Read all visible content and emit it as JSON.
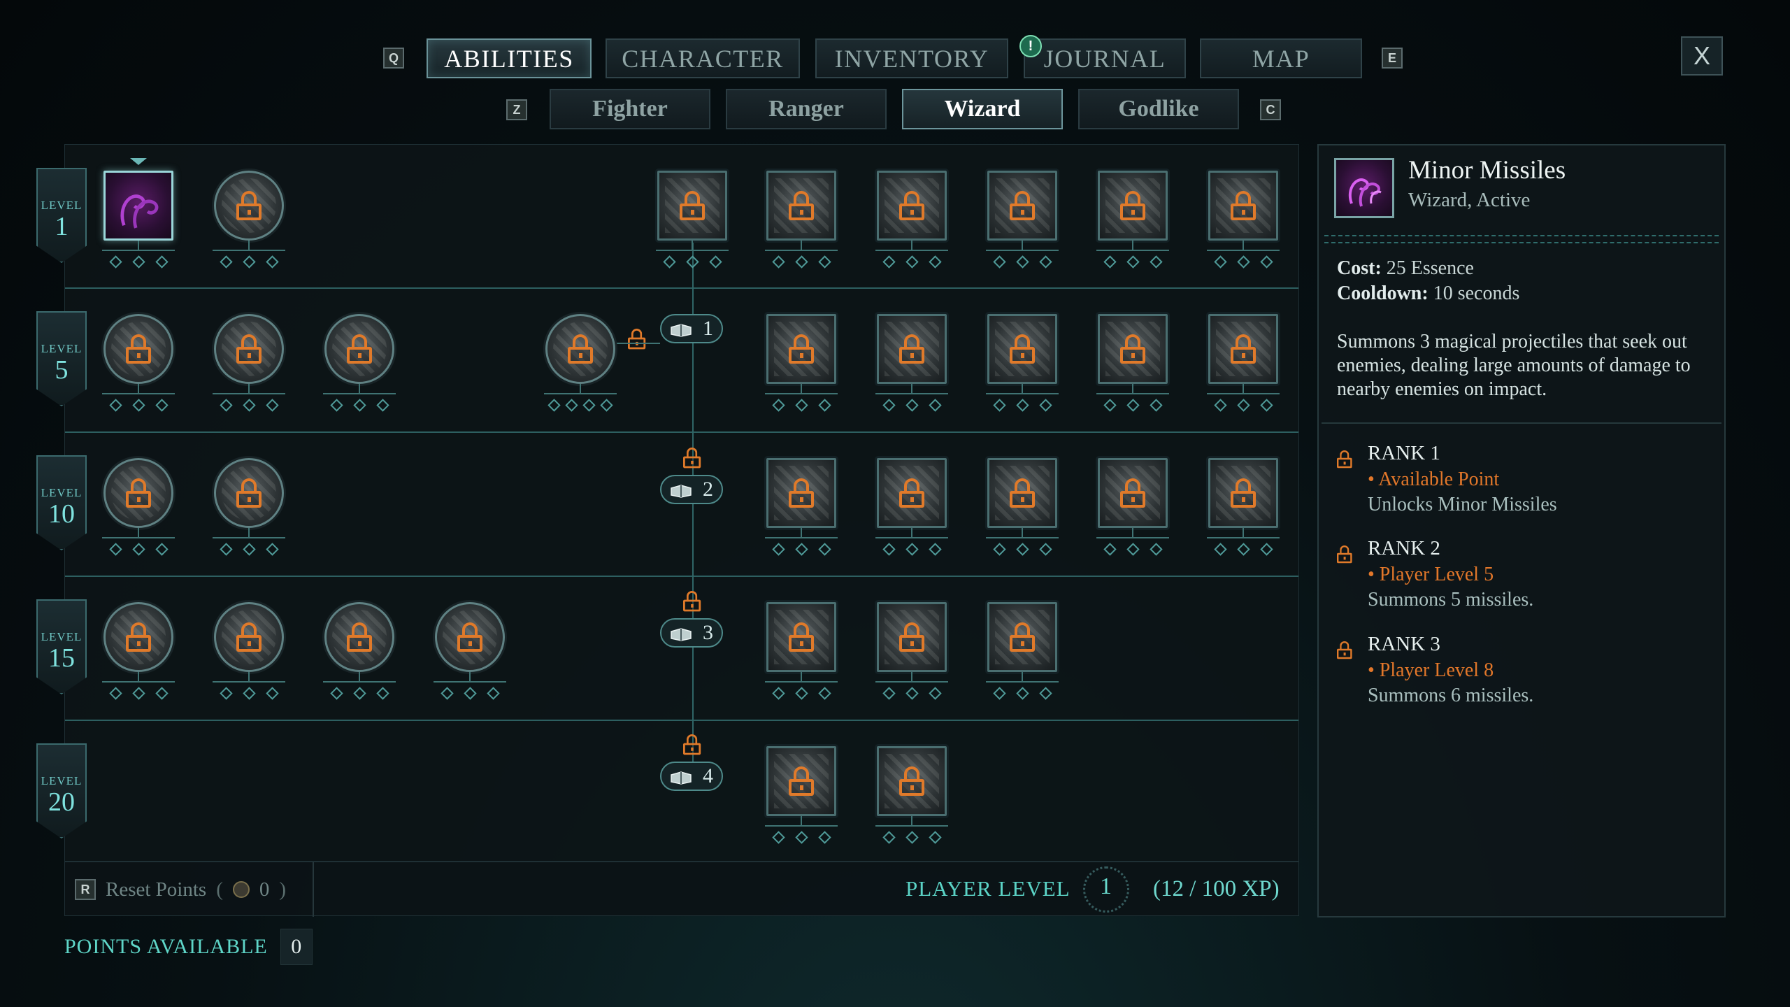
{
  "top_tabs": {
    "left_key": "Q",
    "right_key": "E",
    "items": [
      "ABILITIES",
      "CHARACTER",
      "INVENTORY",
      "JOURNAL",
      "MAP"
    ],
    "active": "ABILITIES",
    "notification": "!"
  },
  "close_label": "X",
  "class_tabs": {
    "left_key": "Z",
    "right_key": "C",
    "items": [
      "Fighter",
      "Ranger",
      "Wizard",
      "Godlike"
    ],
    "active": "Wizard"
  },
  "levels": [
    {
      "word": "LEVEL",
      "number": "1"
    },
    {
      "word": "LEVEL",
      "number": "5"
    },
    {
      "word": "LEVEL",
      "number": "10"
    },
    {
      "word": "LEVEL",
      "number": "15"
    },
    {
      "word": "LEVEL",
      "number": "20"
    }
  ],
  "tiers": [
    "1",
    "2",
    "3",
    "4"
  ],
  "bottom": {
    "reset_key": "R",
    "reset_label": "Reset Points",
    "reset_count": "0",
    "player_level_label": "PLAYER LEVEL",
    "player_level": "1",
    "xp": "(12 / 100 XP)",
    "points_available_label": "POINTS AVAILABLE",
    "points_available": "0"
  },
  "detail": {
    "title": "Minor Missiles",
    "subtitle": "Wizard, Active",
    "cost_label": "Cost:",
    "cost": "25 Essence",
    "cooldown_label": "Cooldown:",
    "cooldown": "10 seconds",
    "description": "Summons 3 magical projectiles that seek out enemies, dealing large amounts of damage to nearby enemies on impact.",
    "ranks": [
      {
        "title": "RANK 1",
        "requirement": "• Available Point",
        "effect": "Unlocks Minor Missiles"
      },
      {
        "title": "RANK 2",
        "requirement": "• Player Level 5",
        "effect": "Summons 5 missiles."
      },
      {
        "title": "RANK 3",
        "requirement": "• Player Level 8",
        "effect": "Summons 6 missiles."
      }
    ]
  },
  "colors": {
    "accent_teal": "#5fd6c8",
    "lock_orange": "#e07a2a",
    "selected_purple": "#b53fd0"
  }
}
